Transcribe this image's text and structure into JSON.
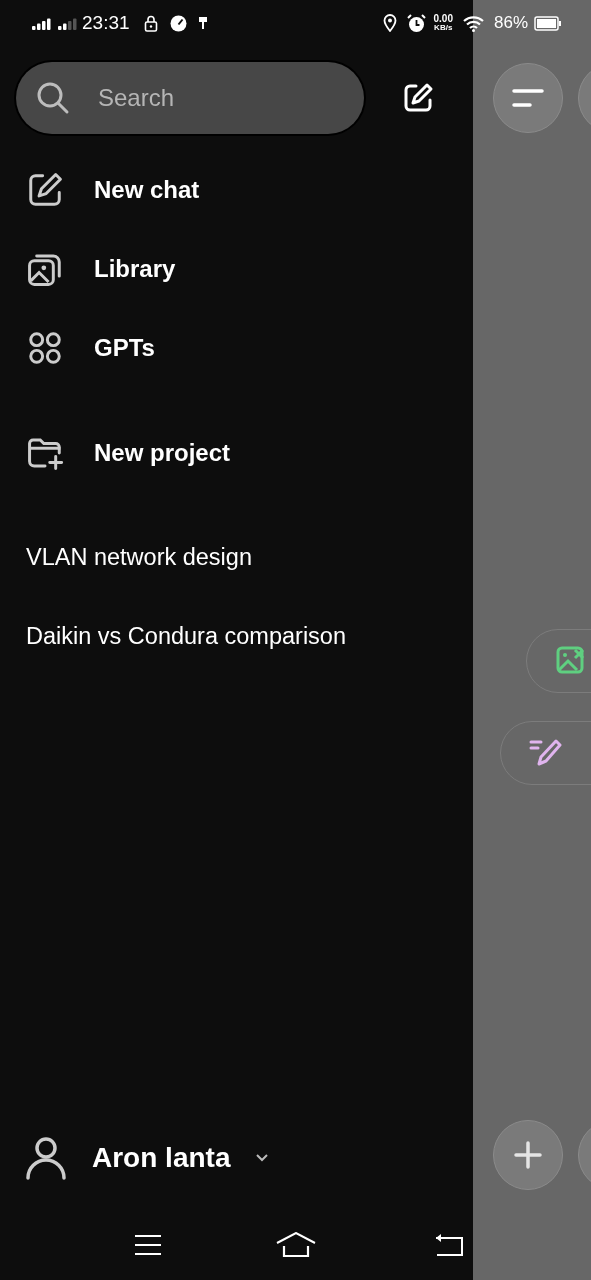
{
  "status_bar": {
    "time": "23:31",
    "network_speed": "0.00",
    "network_unit": "KB/s",
    "battery": "86%"
  },
  "search": {
    "placeholder": "Search"
  },
  "menu": [
    {
      "label": "New chat",
      "kind": "new-chat"
    },
    {
      "label": "Library",
      "kind": "library"
    },
    {
      "label": "GPTs",
      "kind": "gpts"
    }
  ],
  "project": {
    "label": "New project"
  },
  "chats": [
    {
      "title": "VLAN network design"
    },
    {
      "title": "Daikin vs Condura comparison"
    }
  ],
  "profile": {
    "name": "Aron lanta"
  },
  "background": {
    "chips": [
      {
        "kind": "image"
      },
      {
        "kind": "writing"
      }
    ]
  }
}
